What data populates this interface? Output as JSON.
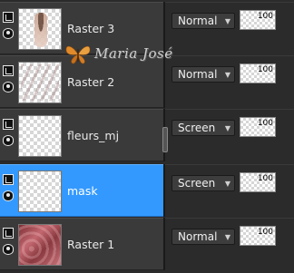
{
  "layers": [
    {
      "name": "Raster 3",
      "blend_mode": "Normal",
      "opacity": "100",
      "selected": false,
      "thumb": "portrait"
    },
    {
      "name": "Raster 2",
      "blend_mode": "Normal",
      "opacity": "100",
      "selected": false,
      "thumb": "streaks"
    },
    {
      "name": "fleurs_mj",
      "blend_mode": "Screen",
      "opacity": "100",
      "selected": false,
      "thumb": "blank"
    },
    {
      "name": "mask",
      "blend_mode": "Screen",
      "opacity": "100",
      "selected": true,
      "thumb": "blank"
    },
    {
      "name": "Raster 1",
      "blend_mode": "Normal",
      "opacity": "100",
      "selected": false,
      "thumb": "pink"
    }
  ],
  "watermark": {
    "text": "Maria José",
    "icon": "butterfly-icon"
  },
  "colors": {
    "selected": "#3399ff",
    "panel": "#3a3a3a",
    "background": "#2b2b2b",
    "watermark_butterfly": "#e08a2a"
  }
}
